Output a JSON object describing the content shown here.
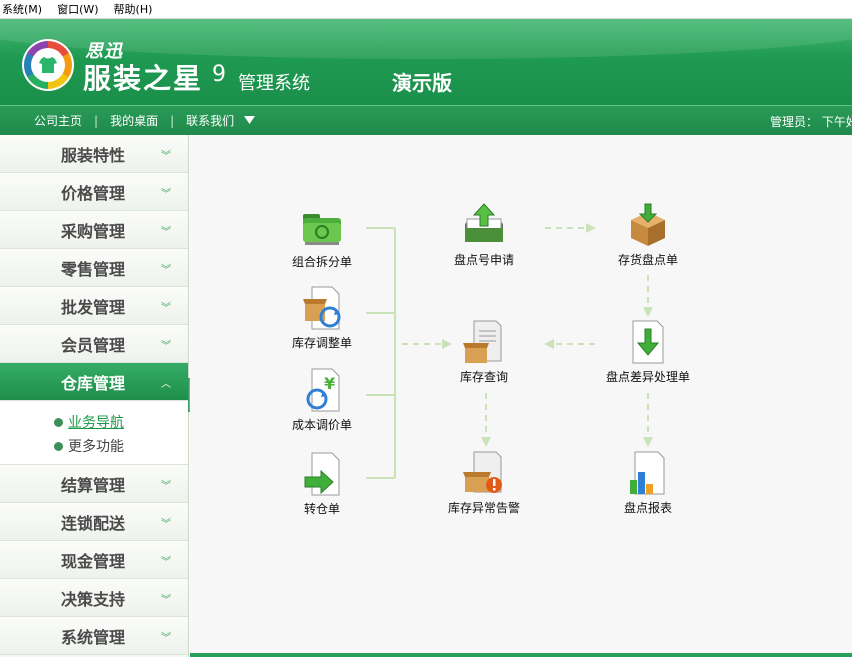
{
  "menu": {
    "items": [
      "系统(M)",
      "窗口(W)",
      "帮助(H)"
    ]
  },
  "header": {
    "brand_sub": "思迅",
    "brand_main": "服装之星",
    "version": "9",
    "system_label": "管理系统",
    "edition": "演示版"
  },
  "nav": {
    "links": [
      "公司主页",
      "我的桌面",
      "联系我们"
    ],
    "dropdown_icon": "triangle-down-icon",
    "right_text": "管理员：  下午好"
  },
  "sidebar": {
    "items_before": [
      "服装特性",
      "价格管理",
      "采购管理",
      "零售管理",
      "批发管理",
      "会员管理"
    ],
    "active_item": "仓库管理",
    "sub_links": [
      "业务导航",
      "更多功能"
    ],
    "items_after": [
      "结算管理",
      "连锁配送",
      "现金管理",
      "决策支持",
      "系统管理"
    ]
  },
  "flow": {
    "nodes": {
      "combo_split": "组合拆分单",
      "stock_adjust": "库存调整单",
      "cost_adjust": "成本调价单",
      "transfer": "转仓单",
      "count_apply": "盘点号申请",
      "inventory_count": "存货盘点单",
      "stock_query": "库存查询",
      "count_diff": "盘点差异处理单",
      "stock_alert": "库存异常告警",
      "count_report": "盘点报表"
    }
  },
  "colors": {
    "brand_green": "#1f9a52",
    "accent_green": "#3aa55e",
    "flow_line": "#c9e2b8"
  }
}
